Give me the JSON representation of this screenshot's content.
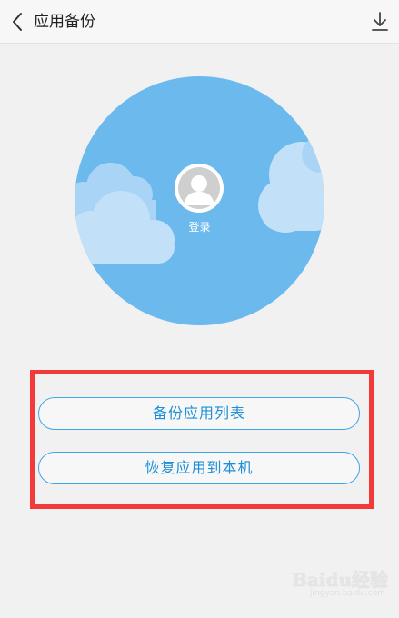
{
  "header": {
    "title": "应用备份",
    "back_icon": "chevron-left-icon",
    "download_icon": "download-icon"
  },
  "profile": {
    "login_label": "登录",
    "avatar_icon": "user-avatar-icon"
  },
  "actions": {
    "backup_label": "备份应用列表",
    "restore_label": "恢复应用到本机"
  },
  "watermark": {
    "brand": "Baidu经验",
    "url": "jingyan.baidu.com"
  },
  "colors": {
    "hero_blue": "#6cb9ee",
    "accent_blue": "#1c8fd6",
    "highlight_red": "#f23a3a",
    "background": "#f1f1f1"
  }
}
